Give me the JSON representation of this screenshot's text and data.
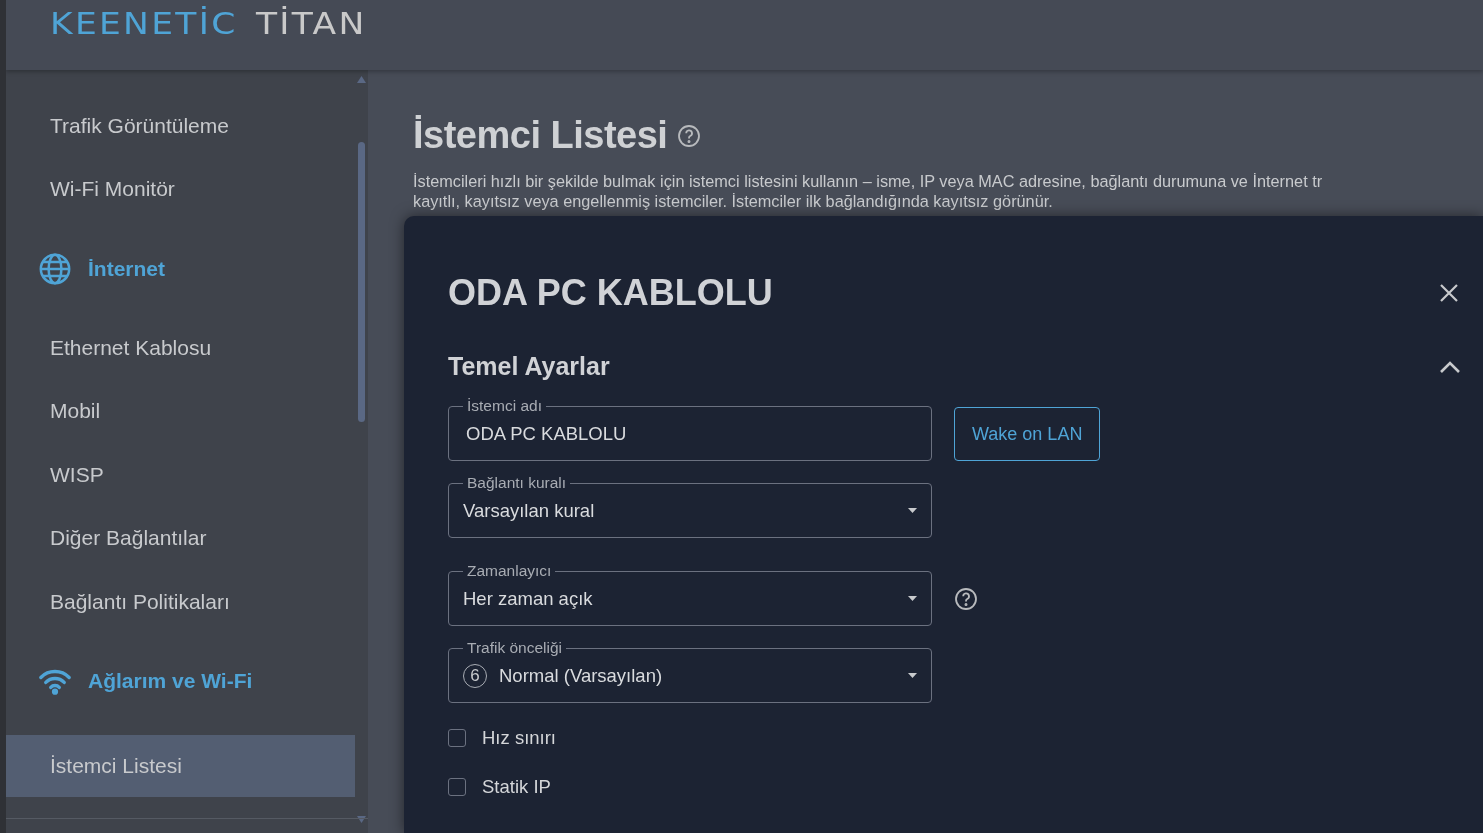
{
  "header": {
    "logo_brand": "KEENETİC",
    "logo_model": "TİTAN"
  },
  "sidebar": {
    "items": [
      {
        "kind": "item",
        "label": "Trafik Görüntüleme",
        "selected": false
      },
      {
        "kind": "item",
        "label": "Wi-Fi Monitör",
        "selected": false
      },
      {
        "kind": "section",
        "label": "İnternet",
        "selected": false
      },
      {
        "kind": "item",
        "label": "Ethernet Kablosu",
        "selected": false
      },
      {
        "kind": "item",
        "label": "Mobil",
        "selected": false
      },
      {
        "kind": "item",
        "label": "WISP",
        "selected": false
      },
      {
        "kind": "item",
        "label": "Diğer Bağlantılar",
        "selected": false
      },
      {
        "kind": "item",
        "label": "Bağlantı Politikaları",
        "selected": false
      },
      {
        "kind": "section",
        "label": "Ağlarım ve Wi-Fi",
        "selected": false
      },
      {
        "kind": "item",
        "label": "İstemci Listesi",
        "selected": true
      }
    ]
  },
  "page": {
    "title": "İstemci Listesi",
    "description_lines": [
      "İstemcileri hızlı bir şekilde bulmak için istemci listesini kullanın – isme, IP veya MAC adresine, bağlantı durumuna ve İnternet tr",
      "kayıtlı, kayıtsız veya engellenmiş istemciler. İstemciler ilk bağlandığında kayıtsız görünür."
    ]
  },
  "dialog": {
    "title": "ODA PC KABLOLU",
    "section": {
      "title": "Temel Ayarlar",
      "expanded": true
    },
    "fields": [
      {
        "kind": "text",
        "label": "İstemci adı",
        "value": "ODA PC KABLOLU",
        "button": "Wake on LAN"
      },
      {
        "kind": "select",
        "label": "Bağlantı kuralı",
        "value": "Varsayılan kural"
      },
      {
        "kind": "select",
        "label": "Zamanlayıcı",
        "value": "Her zaman açık",
        "help": true
      },
      {
        "kind": "select",
        "label": "Trafik önceliği",
        "value": "Normal (Varsayılan)",
        "badge": "6"
      }
    ],
    "checkboxes": [
      {
        "label": "Hız sınırı",
        "checked": false
      },
      {
        "label": "Statik IP",
        "checked": false
      }
    ]
  }
}
